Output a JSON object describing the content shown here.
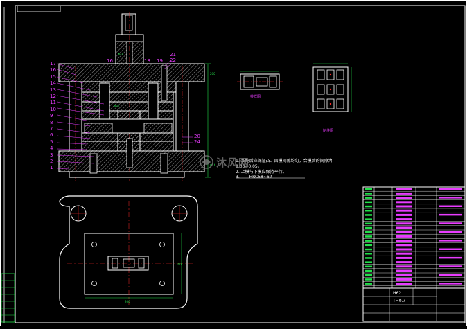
{
  "drawing": {
    "section_part_numbers": [
      "17",
      "16",
      "15",
      "14",
      "13",
      "12",
      "11",
      "10",
      "9",
      "8",
      "7",
      "6",
      "5",
      "4",
      "3",
      "2",
      "1"
    ],
    "top_labels": [
      "18",
      "19",
      "21",
      "22"
    ],
    "right_labels": [
      "20",
      "24"
    ],
    "mid_label": "16",
    "strip_caption": "排样图",
    "part_caption": "制件图",
    "technical_notes": {
      "n1": "1. 装配后应保证凸、凹模间隙均匀，合模后的间隙为",
      "n1b": "0.03~0.05。",
      "n2": "2. 上模与下模应保持平行。",
      "n3": "3. ____HRC58~62"
    },
    "title_block": {
      "material": "H62",
      "thickness": "T=0.7"
    }
  },
  "watermark": {
    "text": "沐风网"
  },
  "colors": {
    "background": "#000000",
    "outline": "#ffffff",
    "centerline": "#ff2b2b",
    "dimension": "#22e04a",
    "label": "#e83cff",
    "hatch": "#b8b8b8"
  }
}
